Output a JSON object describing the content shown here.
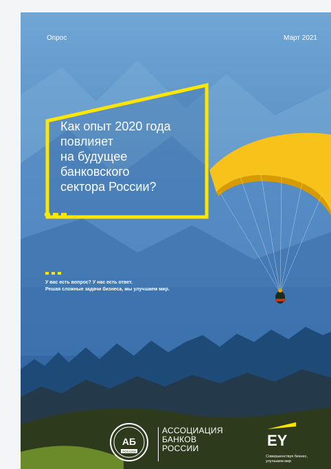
{
  "cover": {
    "top_left": "Опрос",
    "top_right": "Март 2021",
    "headline": [
      "Как опыт 2020 года",
      "повлияет",
      "на будущее",
      "банковского",
      "сектора России?"
    ],
    "tagline": [
      "У вас есть вопрос? У нас есть ответ.",
      "Решая сложные задачи бизнеса, мы улучшаем мир."
    ],
    "accent_color": "#ffe600"
  },
  "footer": {
    "association_name": [
      "АССОЦИАЦИЯ",
      "БАНКОВ",
      "РОССИИ"
    ],
    "association_logo_text": "АБ",
    "association_seal_text": "РОССИИ",
    "ey_logo_text": "EY",
    "ey_slogan": [
      "Совершенствуя бизнес,",
      "улучшаем мир"
    ]
  },
  "icons": {
    "association_logo": "association-seal-icon",
    "ey_logo": "ey-logo-icon",
    "paraglider": "paraglider-icon"
  }
}
